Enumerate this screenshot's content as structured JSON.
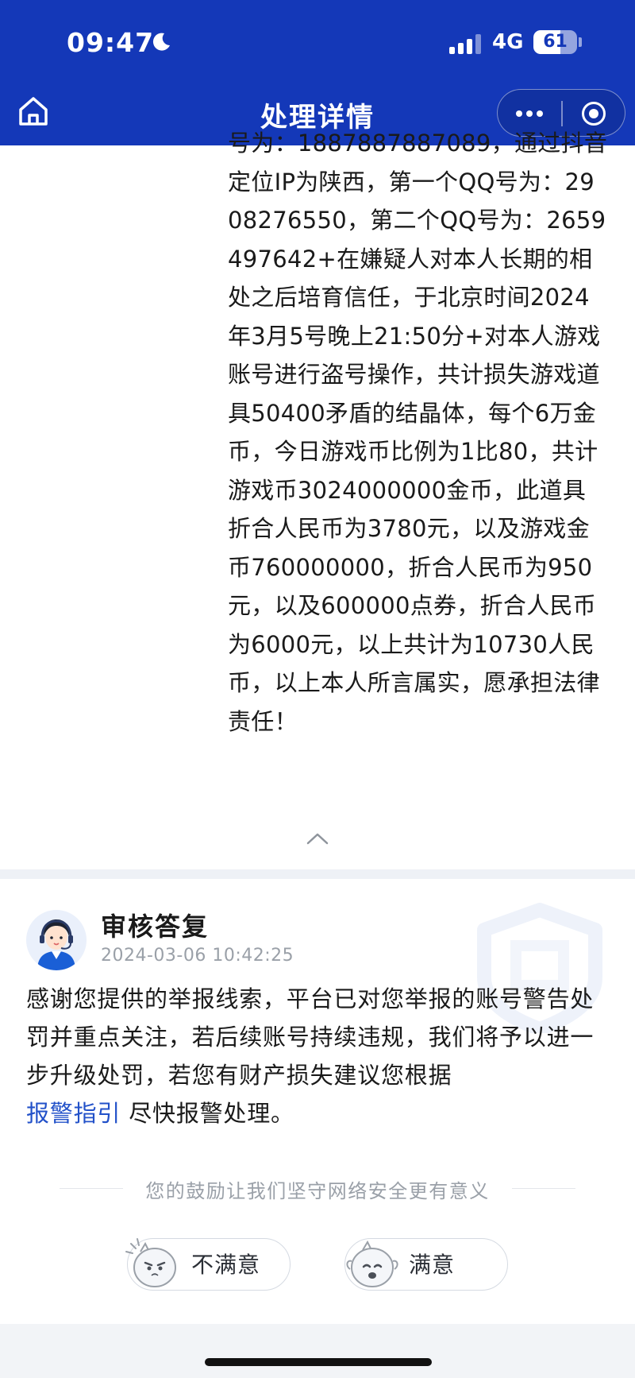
{
  "status_bar": {
    "time": "09:47",
    "network": "4G",
    "battery_level": 61,
    "battery_text": "61"
  },
  "nav": {
    "title": "处理详情"
  },
  "report": {
    "text": "号为：1887887887089，通过抖音定位IP为陕西，第一个QQ号为：2908276550，第二个QQ号为：2659497642+在嫌疑人对本人长期的相处之后培育信任，于北京时间2024年3月5号晚上21:50分+对本人游戏账号进行盗号操作，共计损失游戏道具50400矛盾的结晶体，每个6万金币，今日游戏币比例为1比80，共计游戏币3024000000金币，此道具折合人民币为3780元，以及游戏金币760000000，折合人民币为950元，以及600000点券，折合人民币为6000元，以上共计为10730人民币，以上本人所言属实，愿承担法律责任！"
  },
  "reply": {
    "title": "审核答复",
    "time": "2024-03-06 10:42:25",
    "body_before": "感谢您提供的举报线索，平台已对您举报的账号警告处罚并重点关注，若后续账号持续违规，我们将予以进一步升级处罚，若您有财产损失建议您根据",
    "link": "报警指引",
    "body_after": "尽快报警处理。"
  },
  "feedback": {
    "prompt": "您的鼓励让我们坚守网络安全更有意义",
    "unsatisfied": "不满意",
    "satisfied": "满意"
  },
  "colors": {
    "brand_blue": "#1438b8",
    "link_blue": "#2251c9"
  }
}
